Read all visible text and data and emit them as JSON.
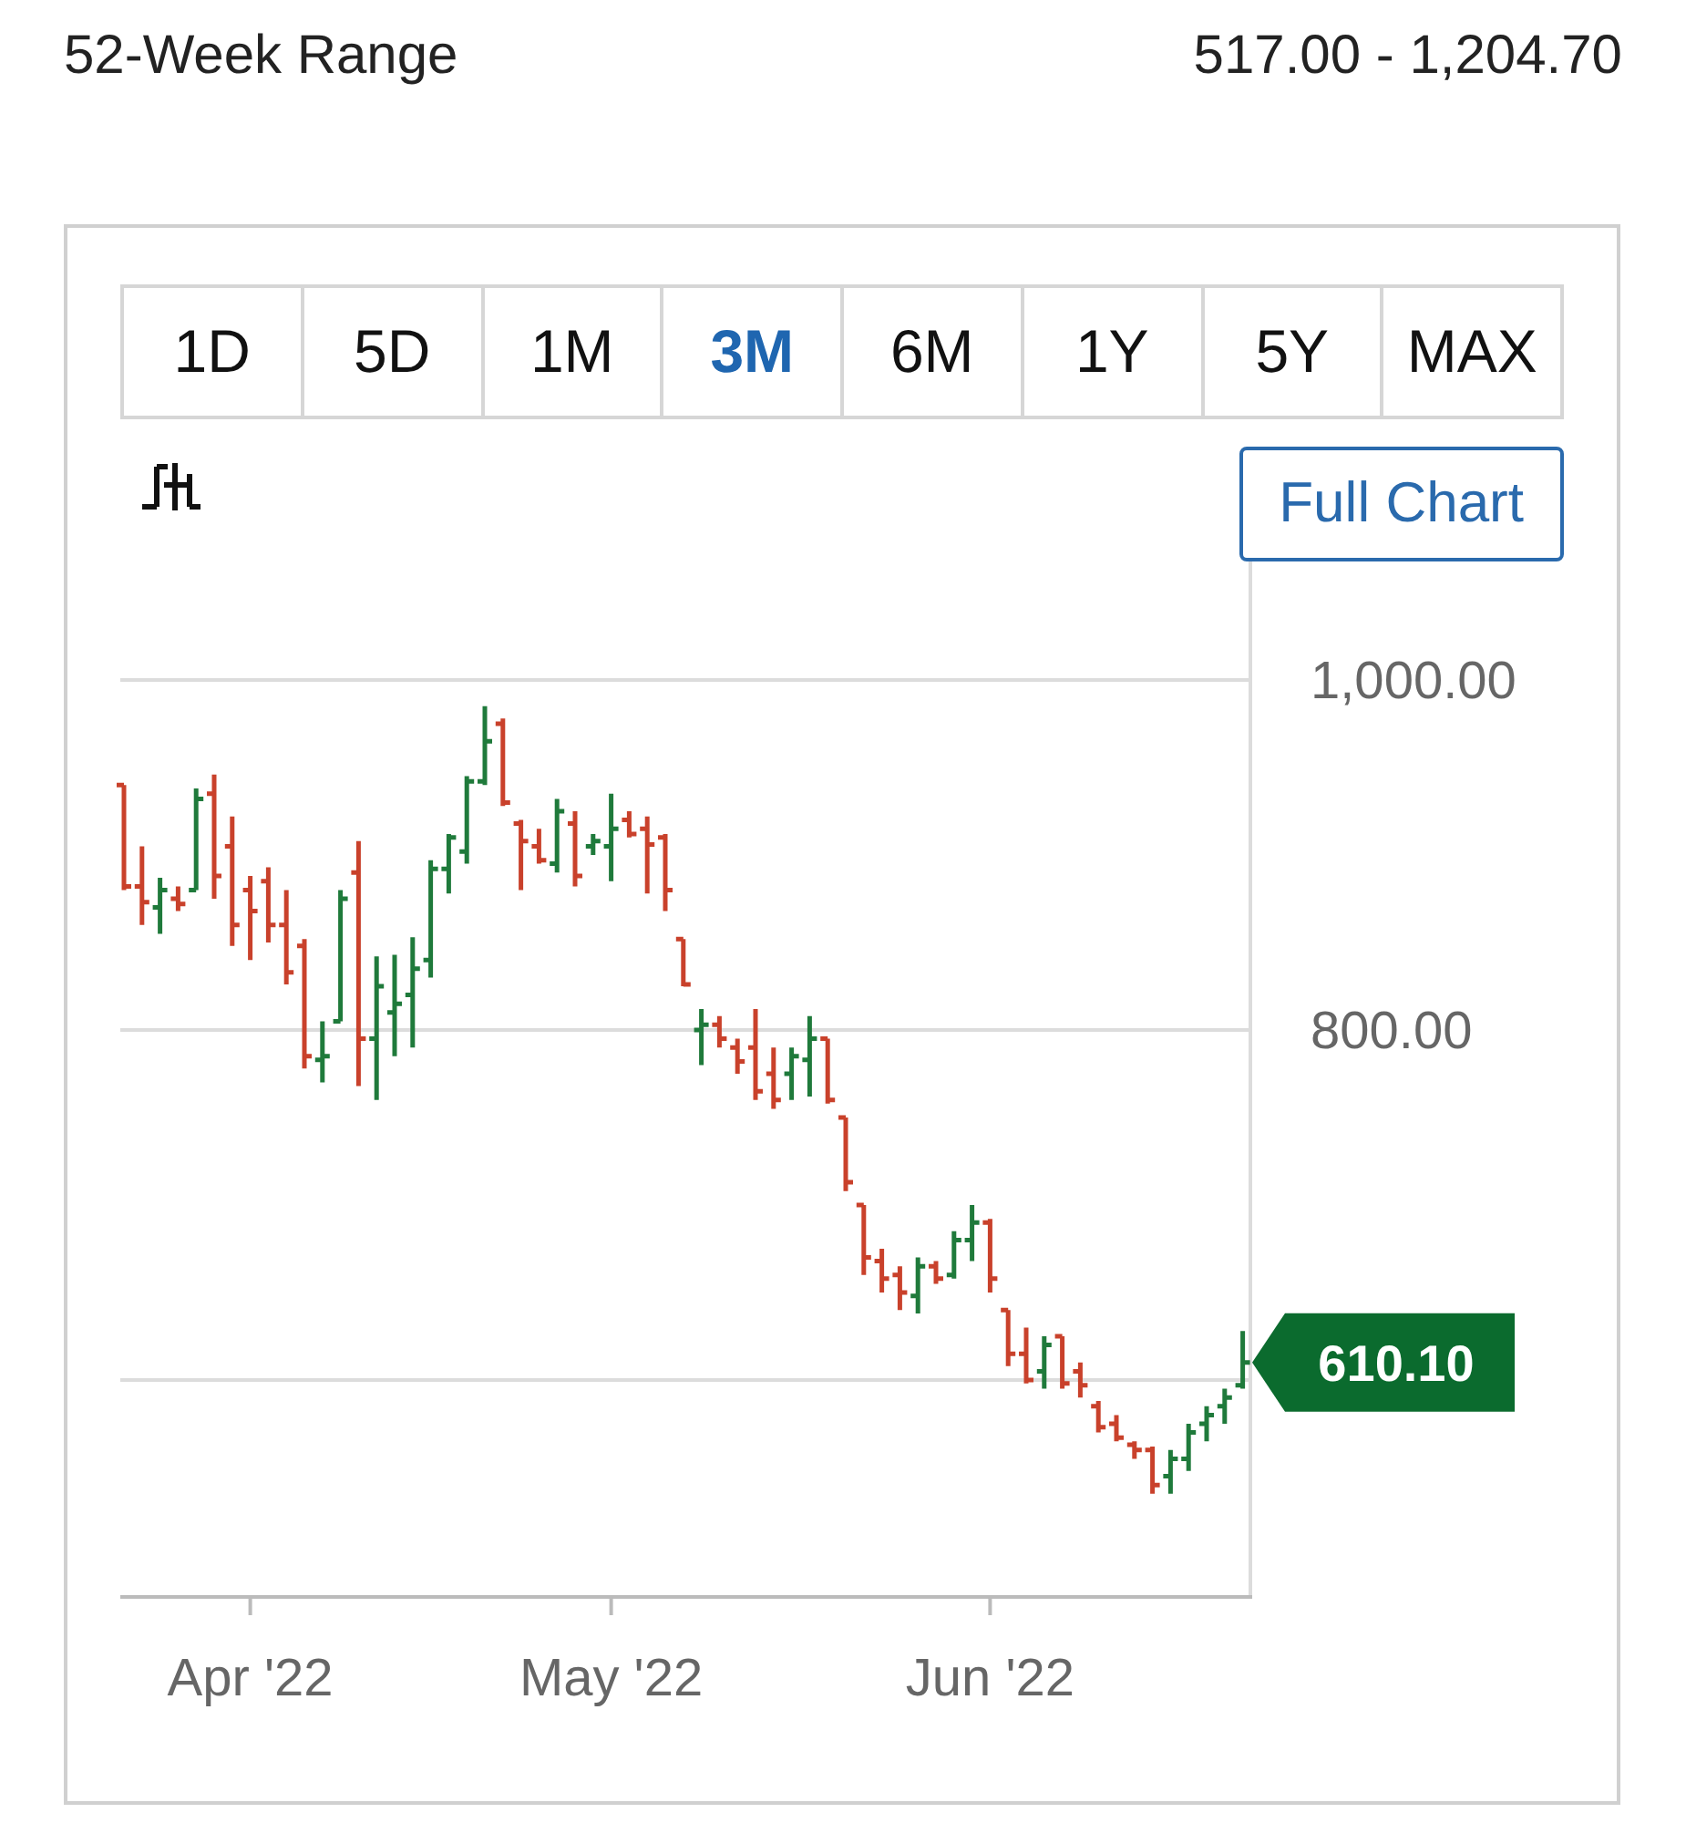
{
  "header": {
    "label": "52-Week Range",
    "value": "517.00 - 1,204.70"
  },
  "tabs": [
    {
      "label": "1D",
      "selected": false
    },
    {
      "label": "5D",
      "selected": false
    },
    {
      "label": "1M",
      "selected": false
    },
    {
      "label": "3M",
      "selected": true
    },
    {
      "label": "6M",
      "selected": false
    },
    {
      "label": "1Y",
      "selected": false
    },
    {
      "label": "5Y",
      "selected": false
    },
    {
      "label": "MAX",
      "selected": false
    }
  ],
  "full_chart_button": "Full Chart",
  "chart": {
    "y_axis_labels": [
      "1,000.00",
      "800.00"
    ],
    "x_axis_labels": [
      "Apr '22",
      "May '22",
      "Jun '22"
    ],
    "price_tag": "610.10"
  }
}
